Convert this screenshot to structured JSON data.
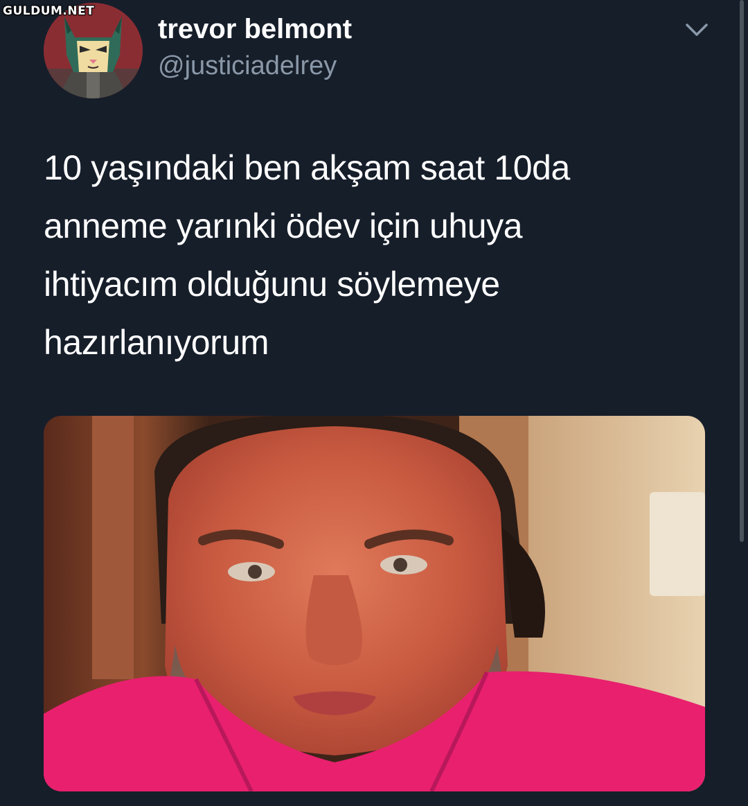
{
  "watermark": "GULDUM.NET",
  "tweet": {
    "display_name": "trevor belmont",
    "handle": "@justiciadelrey",
    "text_lines": [
      "10 yaşındaki ben akşam saat 10da",
      "anneme yarınki ödev için uhuya",
      "ihtiyacım olduğunu söylemeye",
      "hazırlanıyorum"
    ],
    "avatar_icon": "cartoon-cat-avatar",
    "menu_icon": "chevron-down-icon",
    "media_description": "photo"
  },
  "colors": {
    "background": "#161e2a",
    "text_primary": "#ffffff",
    "text_secondary": "#8a98a8",
    "shirt_pink": "#e8206e"
  }
}
